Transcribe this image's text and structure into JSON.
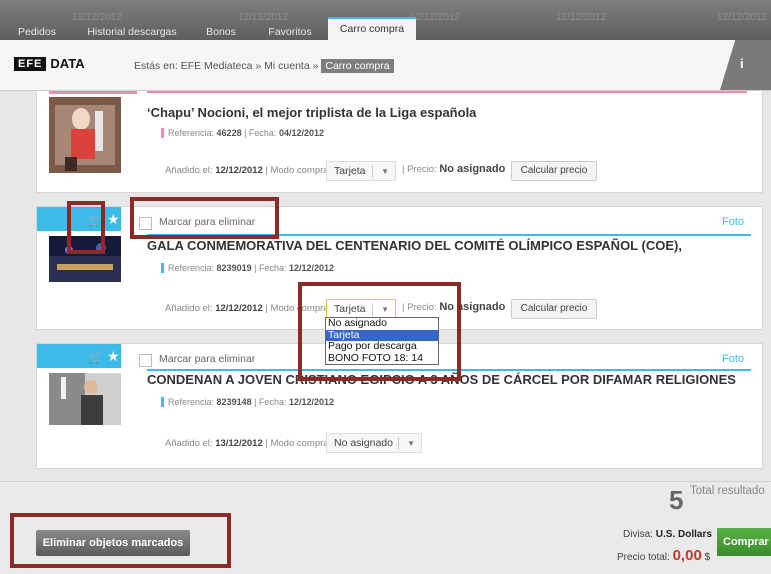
{
  "tabs": [
    {
      "label": "Pedidos"
    },
    {
      "label": "Historial descargas"
    },
    {
      "label": "Bonos"
    },
    {
      "label": "Favoritos"
    },
    {
      "label": "Carro compra"
    }
  ],
  "background_dates": [
    "12/12/2012",
    "12/12/2012",
    "12/12/2012",
    "12/12/2012",
    "12/12/2012"
  ],
  "logo": {
    "efe": "EFE",
    "data": "DATA"
  },
  "breadcrumb": {
    "prefix": "Estás en: EFE Mediateca » Mi cuenta »",
    "current": "Carro compra"
  },
  "info_label": "i",
  "items": [
    {
      "title": "‘Chapu’ Nocioni, el mejor triplista de la Liga española",
      "ref_label": "Referencia:",
      "ref": "46228",
      "fecha_label": "Fecha:",
      "fecha": "04/12/2012",
      "added_label": "Añadido el:",
      "added": "12/12/2012",
      "mode_label": "Modo compra:",
      "mode": "Tarjeta",
      "price_label": "Precio:",
      "price": "No asignado",
      "calc_label": "Calcular precio"
    },
    {
      "marcar": "Marcar para eliminar",
      "type": "Foto",
      "title": "GALA CONMEMORATIVA DEL CENTENARIO DEL COMITÉ OLÍMPICO ESPAÑOL (COE),",
      "ref_label": "Referencia:",
      "ref": "8239019",
      "fecha_label": "Fecha:",
      "fecha": "12/12/2012",
      "added_label": "Añadido el:",
      "added": "12/12/2012",
      "mode_label": "Modo compra:",
      "mode": "Tarjeta",
      "price_label": "Precio:",
      "price": "No asignado",
      "calc_label": "Calcular precio"
    },
    {
      "marcar": "Marcar para eliminar",
      "type": "Foto",
      "title": "CONDENAN A JOVEN CRISTIANO EGIPCIO A 3 AÑOS DE CÁRCEL POR DIFAMAR RELIGIONES",
      "ref_label": "Referencia:",
      "ref": "8239148",
      "fecha_label": "Fecha:",
      "fecha": "12/12/2012",
      "added_label": "Añadido el:",
      "added": "13/12/2012",
      "mode_label": "Modo compra:",
      "mode": "No asignado"
    }
  ],
  "dropdown_options": [
    "No asignado",
    "Tarjeta",
    "Pago por descarga",
    "BONO FOTO 18: 14"
  ],
  "dropdown_selected": "Tarjeta",
  "footer": {
    "count": "5",
    "count_label": "Total resultado",
    "delete_label": "Eliminar objetos marcados",
    "divisa_label": "Divisa:",
    "divisa": "U.S. Dollars",
    "total_label": "Precio total:",
    "total": "0,00",
    "currency": "$",
    "buy_label": "Comprar"
  },
  "icons": {
    "cart": "cart-icon",
    "star": "star-icon",
    "chevron": "chevron-down-icon"
  },
  "colors": {
    "accent": "#3cbbe9",
    "highlight_box": "#8c2a2a",
    "buy": "#3a8d2c",
    "price_total": "#c0392b"
  }
}
